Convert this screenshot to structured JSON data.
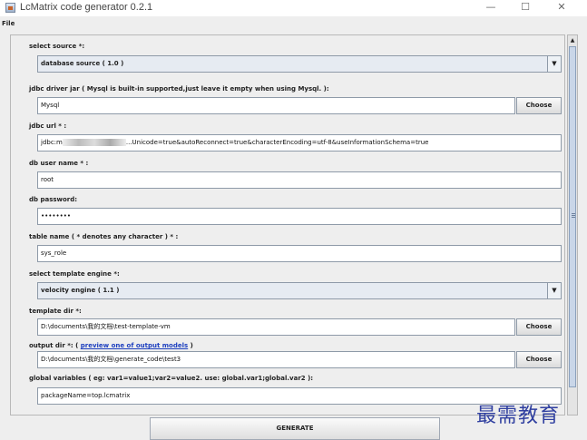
{
  "window": {
    "title": "LcMatrix code generator 0.2.1",
    "minimize": "—",
    "maximize": "☐",
    "close": "✕"
  },
  "menu": {
    "file": "File"
  },
  "form": {
    "source_label": "select source *:",
    "source_value": "database source ( 1.0 )",
    "jar_label": "jdbc driver jar ( Mysql is built-in supported,just leave it empty when using Mysql. ):",
    "jar_value": "Mysql",
    "choose_label": "Choose",
    "url_label": "jdbc url * :",
    "url_prefix": "jdbc:m",
    "url_suffix": "...Unicode=true&autoReconnect=true&characterEncoding=utf-8&useInformationSchema=true",
    "user_label": "db user name * :",
    "user_value": "root",
    "password_label": "db password:",
    "password_value": "••••••••",
    "table_label": "table name ( * denotes any character ) * :",
    "table_value": "sys_role",
    "engine_label": "select template engine *:",
    "engine_value": "velocity engine ( 1.1 )",
    "template_label": "template dir *:",
    "template_value": "D:\\documents\\我的文档\\test-template-vm",
    "output_label": "output dir *: (",
    "output_link": "preview one of output models",
    "output_label_end": ")",
    "output_value": "D:\\documents\\我的文档\\generate_code\\test3",
    "vars_label": "global variables ( eg: var1=value1;var2=value2. use: global.var1;global.var2 ):",
    "vars_value": "packageName=top.lcmatrix"
  },
  "generate_label": "GENERATE",
  "watermark": "最需教育"
}
